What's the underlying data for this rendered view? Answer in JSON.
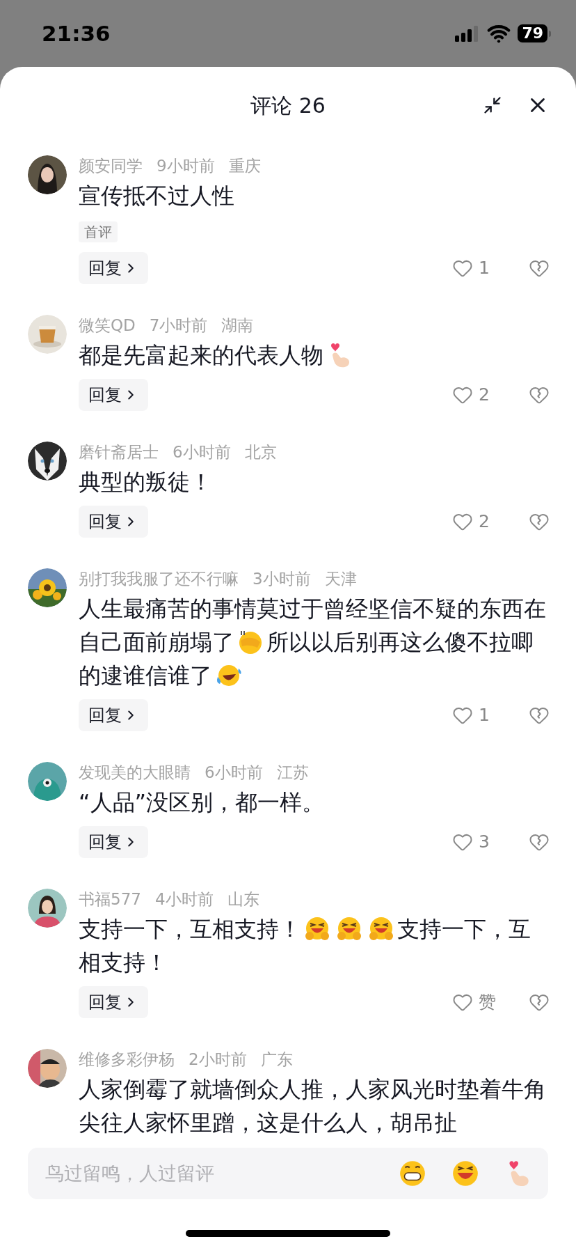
{
  "status_bar": {
    "time": "21:36",
    "battery": "79"
  },
  "sheet": {
    "title": "评论 26"
  },
  "comments": [
    {
      "user": "颜安同学",
      "time": "9小时前",
      "location": "重庆",
      "lines": [
        [
          {
            "kind": "text",
            "text": "宣传抵不过人性"
          }
        ]
      ],
      "tag": "首评",
      "reply": "回复",
      "likes": "1"
    },
    {
      "user": "微笑QD",
      "time": "7小时前",
      "location": "湖南",
      "lines": [
        [
          {
            "kind": "text",
            "text": "都是先富起来的代表人物"
          },
          {
            "kind": "fingerheart"
          }
        ]
      ],
      "reply": "回复",
      "likes": "2"
    },
    {
      "user": "磨针斋居士",
      "time": "6小时前",
      "location": "北京",
      "lines": [
        [
          {
            "kind": "text",
            "text": "典型的叛徒！"
          }
        ]
      ],
      "reply": "回复",
      "likes": "2"
    },
    {
      "user": "别打我我服了还不行嘛",
      "time": "3小时前",
      "location": "天津",
      "lines": [
        [
          {
            "kind": "text",
            "text": "人生最痛苦的事情莫过于曾经坚信不疑的东西在"
          }
        ],
        [
          {
            "kind": "text",
            "text": "自己面前崩塌了"
          },
          {
            "kind": "facepalm"
          },
          {
            "kind": "text",
            "text": "所以以后别再这么傻不拉唧"
          }
        ],
        [
          {
            "kind": "text",
            "text": "的逮谁信谁了"
          },
          {
            "kind": "tearslaugh"
          }
        ]
      ],
      "reply": "回复",
      "likes": "1"
    },
    {
      "user": "发现美的大眼睛",
      "time": "6小时前",
      "location": "江苏",
      "lines": [
        [
          {
            "kind": "text",
            "text": "“人品”没区别，都一样。"
          }
        ]
      ],
      "reply": "回复",
      "likes": "3"
    },
    {
      "user": "书福577",
      "time": "4小时前",
      "location": "山东",
      "lines": [
        [
          {
            "kind": "text",
            "text": "支持一下，互相支持！"
          },
          {
            "kind": "hugface"
          },
          {
            "kind": "hugface"
          },
          {
            "kind": "hugface"
          },
          {
            "kind": "text",
            "text": "支持一下，互"
          }
        ],
        [
          {
            "kind": "text",
            "text": "相支持！"
          }
        ]
      ],
      "reply": "回复",
      "likes": "赞"
    },
    {
      "user": "维修多彩伊杨",
      "time": "2小时前",
      "location": "广东",
      "lines": [
        [
          {
            "kind": "text",
            "text": "人家倒霉了就墙倒众人推，人家风光时垫着牛角"
          }
        ],
        [
          {
            "kind": "text",
            "text": "尖往人家怀里蹭，这是什么人，胡吊扯"
          }
        ]
      ]
    }
  ],
  "input": {
    "placeholder": "鸟过留鸣，人过留评",
    "emojis": [
      {
        "kind": "grin"
      },
      {
        "kind": "laugh"
      },
      {
        "kind": "fingerheart"
      }
    ]
  }
}
